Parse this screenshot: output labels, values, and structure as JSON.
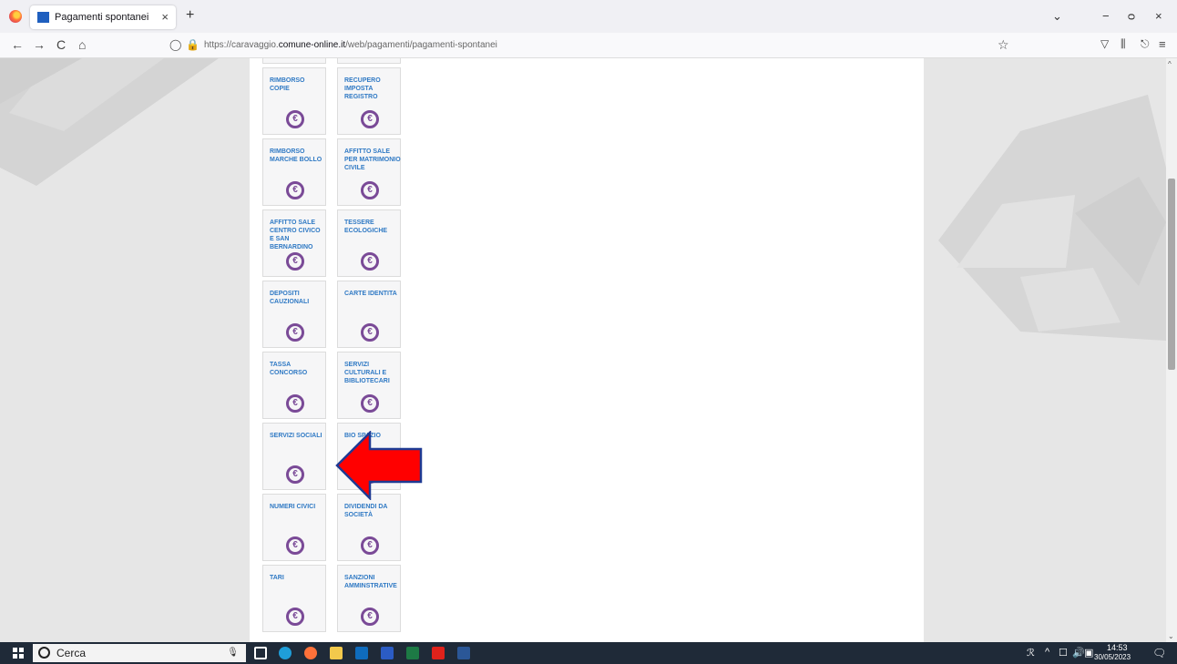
{
  "browser": {
    "tab_title": "Pagamenti spontanei",
    "tab_close": "×",
    "new_tab": "+",
    "url_host": "https://caravaggio.",
    "url_domain": "comune-online.it",
    "url_path": "/web/pagamenti/pagamenti-spontanei",
    "nav": {
      "back": "←",
      "forward": "→",
      "reload": "C",
      "home": "⌂",
      "star": "☆"
    },
    "window": {
      "list": "⌄",
      "minimize": "−",
      "maximize": "ᴑ",
      "close": "×"
    },
    "toolbar": {
      "pocket": "▽",
      "library": "⫼",
      "share": "⎋",
      "menu": "≡"
    }
  },
  "services": [
    {
      "label": "",
      "col": 0,
      "row": -1
    },
    {
      "label": "",
      "col": 1,
      "row": -1
    },
    {
      "label": "RIMBORSO COPIE"
    },
    {
      "label": "RECUPERO IMPOSTA REGISTRO"
    },
    {
      "label": "RIMBORSO MARCHE BOLLO"
    },
    {
      "label": "AFFITTO SALE PER MATRIMONIO CIVILE"
    },
    {
      "label": "AFFITTO SALE CENTRO CIVICO E SAN BERNARDINO"
    },
    {
      "label": "TESSERE ECOLOGICHE"
    },
    {
      "label": "DEPOSITI CAUZIONALI"
    },
    {
      "label": "CARTE IDENTITA"
    },
    {
      "label": "TASSA CONCORSO"
    },
    {
      "label": "SERVIZI CULTURALI E BIBLIOTECARI"
    },
    {
      "label": "SERVIZI SOCIALI"
    },
    {
      "label": "BIO SPAZIO"
    },
    {
      "label": "NUMERI CIVICI"
    },
    {
      "label": "DIVIDENDI DA SOCIETÀ"
    },
    {
      "label": "TARI"
    },
    {
      "label": "SANZIONI AMMINSTRATIVE"
    }
  ],
  "euro_symbol": "€",
  "scrollbar": {
    "up": "^",
    "down": "⌄"
  },
  "taskbar": {
    "search_placeholder": "Cerca",
    "clock_time": "14:53",
    "clock_date": "30/05/2023",
    "tray": {
      "people": "ℛ",
      "chevron": "^",
      "network": "☐",
      "volume": "🔊",
      "notifications": "▣"
    },
    "icon_colors": {
      "edge": "#1f9ed9",
      "firefox": "#ff7139",
      "explorer": "#f2c94c",
      "outlook": "#0f6cbd",
      "app": "#2b5cc4",
      "excel": "#1d7a45",
      "acrobat": "#e0221b",
      "word": "#2b5797"
    }
  },
  "colors": {
    "tile_text": "#2f79c4",
    "euro_icon": "#7a4a97",
    "arrow_fill": "#ff0000",
    "arrow_stroke": "#1f3a93"
  }
}
